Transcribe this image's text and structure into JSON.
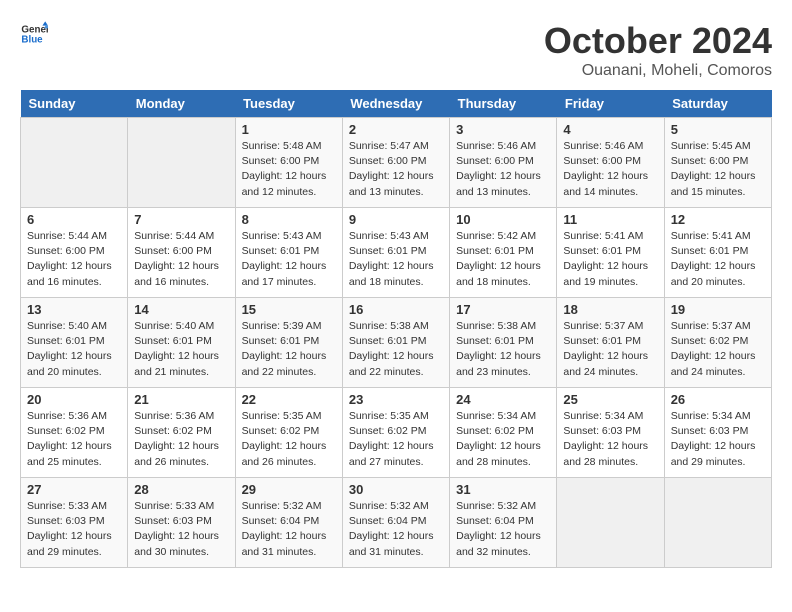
{
  "header": {
    "logo_general": "General",
    "logo_blue": "Blue",
    "title": "October 2024",
    "subtitle": "Ouanani, Moheli, Comoros"
  },
  "calendar": {
    "days_of_week": [
      "Sunday",
      "Monday",
      "Tuesday",
      "Wednesday",
      "Thursday",
      "Friday",
      "Saturday"
    ],
    "weeks": [
      [
        {
          "day": "",
          "info": ""
        },
        {
          "day": "",
          "info": ""
        },
        {
          "day": "1",
          "info": "Sunrise: 5:48 AM\nSunset: 6:00 PM\nDaylight: 12 hours\nand 12 minutes."
        },
        {
          "day": "2",
          "info": "Sunrise: 5:47 AM\nSunset: 6:00 PM\nDaylight: 12 hours\nand 13 minutes."
        },
        {
          "day": "3",
          "info": "Sunrise: 5:46 AM\nSunset: 6:00 PM\nDaylight: 12 hours\nand 13 minutes."
        },
        {
          "day": "4",
          "info": "Sunrise: 5:46 AM\nSunset: 6:00 PM\nDaylight: 12 hours\nand 14 minutes."
        },
        {
          "day": "5",
          "info": "Sunrise: 5:45 AM\nSunset: 6:00 PM\nDaylight: 12 hours\nand 15 minutes."
        }
      ],
      [
        {
          "day": "6",
          "info": "Sunrise: 5:44 AM\nSunset: 6:00 PM\nDaylight: 12 hours\nand 16 minutes."
        },
        {
          "day": "7",
          "info": "Sunrise: 5:44 AM\nSunset: 6:00 PM\nDaylight: 12 hours\nand 16 minutes."
        },
        {
          "day": "8",
          "info": "Sunrise: 5:43 AM\nSunset: 6:01 PM\nDaylight: 12 hours\nand 17 minutes."
        },
        {
          "day": "9",
          "info": "Sunrise: 5:43 AM\nSunset: 6:01 PM\nDaylight: 12 hours\nand 18 minutes."
        },
        {
          "day": "10",
          "info": "Sunrise: 5:42 AM\nSunset: 6:01 PM\nDaylight: 12 hours\nand 18 minutes."
        },
        {
          "day": "11",
          "info": "Sunrise: 5:41 AM\nSunset: 6:01 PM\nDaylight: 12 hours\nand 19 minutes."
        },
        {
          "day": "12",
          "info": "Sunrise: 5:41 AM\nSunset: 6:01 PM\nDaylight: 12 hours\nand 20 minutes."
        }
      ],
      [
        {
          "day": "13",
          "info": "Sunrise: 5:40 AM\nSunset: 6:01 PM\nDaylight: 12 hours\nand 20 minutes."
        },
        {
          "day": "14",
          "info": "Sunrise: 5:40 AM\nSunset: 6:01 PM\nDaylight: 12 hours\nand 21 minutes."
        },
        {
          "day": "15",
          "info": "Sunrise: 5:39 AM\nSunset: 6:01 PM\nDaylight: 12 hours\nand 22 minutes."
        },
        {
          "day": "16",
          "info": "Sunrise: 5:38 AM\nSunset: 6:01 PM\nDaylight: 12 hours\nand 22 minutes."
        },
        {
          "day": "17",
          "info": "Sunrise: 5:38 AM\nSunset: 6:01 PM\nDaylight: 12 hours\nand 23 minutes."
        },
        {
          "day": "18",
          "info": "Sunrise: 5:37 AM\nSunset: 6:01 PM\nDaylight: 12 hours\nand 24 minutes."
        },
        {
          "day": "19",
          "info": "Sunrise: 5:37 AM\nSunset: 6:02 PM\nDaylight: 12 hours\nand 24 minutes."
        }
      ],
      [
        {
          "day": "20",
          "info": "Sunrise: 5:36 AM\nSunset: 6:02 PM\nDaylight: 12 hours\nand 25 minutes."
        },
        {
          "day": "21",
          "info": "Sunrise: 5:36 AM\nSunset: 6:02 PM\nDaylight: 12 hours\nand 26 minutes."
        },
        {
          "day": "22",
          "info": "Sunrise: 5:35 AM\nSunset: 6:02 PM\nDaylight: 12 hours\nand 26 minutes."
        },
        {
          "day": "23",
          "info": "Sunrise: 5:35 AM\nSunset: 6:02 PM\nDaylight: 12 hours\nand 27 minutes."
        },
        {
          "day": "24",
          "info": "Sunrise: 5:34 AM\nSunset: 6:02 PM\nDaylight: 12 hours\nand 28 minutes."
        },
        {
          "day": "25",
          "info": "Sunrise: 5:34 AM\nSunset: 6:03 PM\nDaylight: 12 hours\nand 28 minutes."
        },
        {
          "day": "26",
          "info": "Sunrise: 5:34 AM\nSunset: 6:03 PM\nDaylight: 12 hours\nand 29 minutes."
        }
      ],
      [
        {
          "day": "27",
          "info": "Sunrise: 5:33 AM\nSunset: 6:03 PM\nDaylight: 12 hours\nand 29 minutes."
        },
        {
          "day": "28",
          "info": "Sunrise: 5:33 AM\nSunset: 6:03 PM\nDaylight: 12 hours\nand 30 minutes."
        },
        {
          "day": "29",
          "info": "Sunrise: 5:32 AM\nSunset: 6:04 PM\nDaylight: 12 hours\nand 31 minutes."
        },
        {
          "day": "30",
          "info": "Sunrise: 5:32 AM\nSunset: 6:04 PM\nDaylight: 12 hours\nand 31 minutes."
        },
        {
          "day": "31",
          "info": "Sunrise: 5:32 AM\nSunset: 6:04 PM\nDaylight: 12 hours\nand 32 minutes."
        },
        {
          "day": "",
          "info": ""
        },
        {
          "day": "",
          "info": ""
        }
      ]
    ]
  }
}
